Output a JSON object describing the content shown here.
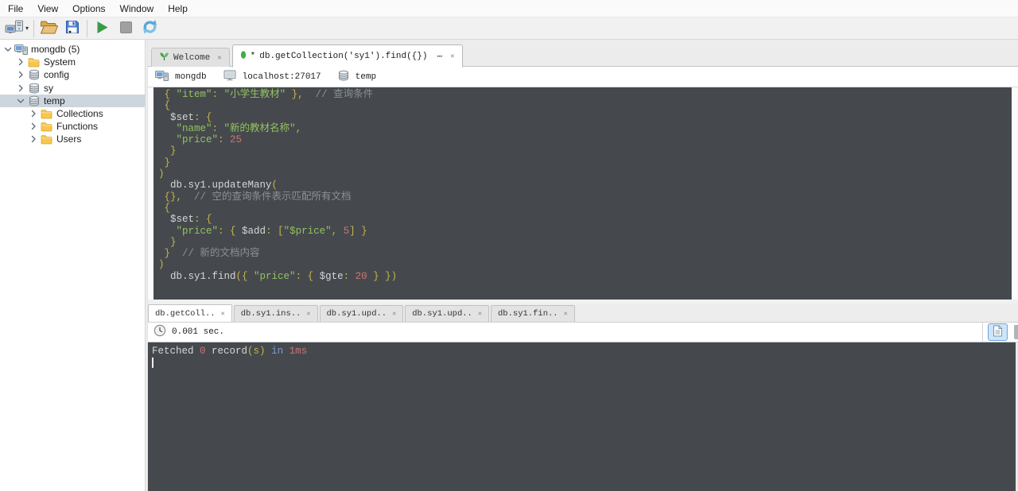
{
  "colors": {
    "editor-bg": "#45494d",
    "token-plain": "#d4d7d9",
    "token-yellow": "#c3b54b",
    "token-green": "#93c25f",
    "token-number": "#cd7572",
    "token-comment": "#8a9197",
    "token-blue": "#7d9cd0",
    "selection-bg": "#cdd6dd",
    "view-btn-bg": "#cfe4f6",
    "view-btn-border": "#6fa6d8"
  },
  "menu_bar": {
    "items": [
      "File",
      "View",
      "Options",
      "Window",
      "Help"
    ]
  },
  "toolbar": {
    "groups": [
      [
        {
          "name": "connect",
          "icon": "connect-icon",
          "dropdown": true
        }
      ],
      [
        {
          "name": "open-file",
          "icon": "folder-open-icon"
        },
        {
          "name": "save",
          "icon": "save-icon"
        }
      ],
      [
        {
          "name": "execute-query",
          "icon": "play-icon"
        },
        {
          "name": "stop",
          "icon": "stop-icon"
        },
        {
          "name": "rotate-results",
          "icon": "rotate-icon"
        }
      ]
    ]
  },
  "sidebar": {
    "tree": [
      {
        "label": "mongdb (5)",
        "icon": "server-icon",
        "chevron": "down",
        "level": 0,
        "selected": false
      },
      {
        "label": "System",
        "icon": "folder-icon",
        "chevron": "right",
        "level": 1,
        "selected": false
      },
      {
        "label": "config",
        "icon": "database-icon",
        "chevron": "right",
        "level": 1,
        "selected": false
      },
      {
        "label": "sy",
        "icon": "database-icon",
        "chevron": "right",
        "level": 1,
        "selected": false
      },
      {
        "label": "temp",
        "icon": "database-icon",
        "chevron": "down",
        "level": 1,
        "selected": true
      },
      {
        "label": "Collections",
        "icon": "folder-icon",
        "chevron": "right",
        "level": 2,
        "selected": false
      },
      {
        "label": "Functions",
        "icon": "folder-icon",
        "chevron": "right",
        "level": 2,
        "selected": false
      },
      {
        "label": "Users",
        "icon": "folder-icon",
        "chevron": "right",
        "level": 2,
        "selected": false
      }
    ]
  },
  "tab_bar": {
    "welcome_tab": {
      "label": "Welcome",
      "icon": "leaf-icon",
      "close": "✕"
    },
    "query_tab": {
      "icon": "green-dot-icon",
      "modified": "*",
      "label": "db.getCollection('sy1').find({})",
      "overflow": "⋯",
      "close": "✕"
    }
  },
  "breadcrumb": {
    "server": {
      "label": "mongdb",
      "icon": "server-icon"
    },
    "host": {
      "label": "localhost:27017",
      "icon": "monitor-icon"
    },
    "database": {
      "label": "temp",
      "icon": "database-icon"
    }
  },
  "editor": {
    "lines": [
      [
        {
          "t": " ",
          "c": "p"
        },
        {
          "t": "{ ",
          "c": "y"
        },
        {
          "t": "\"item\"",
          "c": "g"
        },
        {
          "t": ": ",
          "c": "y"
        },
        {
          "t": "\"小学生教材\"",
          "c": "g"
        },
        {
          "t": " },",
          "c": "y"
        },
        {
          "t": "  ",
          "c": "p"
        },
        {
          "t": "// 查询条件",
          "c": "c"
        }
      ],
      [
        {
          "t": " ",
          "c": "p"
        },
        {
          "t": "{",
          "c": "y"
        }
      ],
      [
        {
          "t": "  ",
          "c": "p"
        },
        {
          "t": "$set",
          "c": "p"
        },
        {
          "t": ": {",
          "c": "y"
        }
      ],
      [
        {
          "t": "   ",
          "c": "p"
        },
        {
          "t": "\"name\"",
          "c": "g"
        },
        {
          "t": ": ",
          "c": "y"
        },
        {
          "t": "\"新的教材名称\"",
          "c": "g"
        },
        {
          "t": ",",
          "c": "y"
        }
      ],
      [
        {
          "t": "   ",
          "c": "p"
        },
        {
          "t": "\"price\"",
          "c": "g"
        },
        {
          "t": ": ",
          "c": "y"
        },
        {
          "t": "25",
          "c": "n"
        }
      ],
      [
        {
          "t": "  ",
          "c": "p"
        },
        {
          "t": "}",
          "c": "y"
        }
      ],
      [
        {
          "t": " ",
          "c": "p"
        },
        {
          "t": "}",
          "c": "y"
        }
      ],
      [
        {
          "t": ")",
          "c": "y"
        }
      ],
      [
        {
          "t": "  ",
          "c": "p"
        },
        {
          "t": "db.sy1.updateMany",
          "c": "p"
        },
        {
          "t": "(",
          "c": "y"
        }
      ],
      [
        {
          "t": " ",
          "c": "p"
        },
        {
          "t": "{},",
          "c": "y"
        },
        {
          "t": "  ",
          "c": "p"
        },
        {
          "t": "// 空的查询条件表示匹配所有文档",
          "c": "c"
        }
      ],
      [
        {
          "t": " ",
          "c": "p"
        },
        {
          "t": "{",
          "c": "y"
        }
      ],
      [
        {
          "t": "  ",
          "c": "p"
        },
        {
          "t": "$set",
          "c": "p"
        },
        {
          "t": ": {",
          "c": "y"
        }
      ],
      [
        {
          "t": "   ",
          "c": "p"
        },
        {
          "t": "\"price\"",
          "c": "g"
        },
        {
          "t": ": { ",
          "c": "y"
        },
        {
          "t": "$add",
          "c": "p"
        },
        {
          "t": ": [",
          "c": "y"
        },
        {
          "t": "\"$price\"",
          "c": "g"
        },
        {
          "t": ", ",
          "c": "y"
        },
        {
          "t": "5",
          "c": "n"
        },
        {
          "t": "] }",
          "c": "y"
        }
      ],
      [
        {
          "t": "  ",
          "c": "p"
        },
        {
          "t": "}",
          "c": "y"
        }
      ],
      [
        {
          "t": " ",
          "c": "p"
        },
        {
          "t": "}",
          "c": "y"
        },
        {
          "t": "  ",
          "c": "p"
        },
        {
          "t": "// 新的文档内容",
          "c": "c"
        }
      ],
      [
        {
          "t": ")",
          "c": "y"
        }
      ],
      [
        {
          "t": "  ",
          "c": "p"
        },
        {
          "t": "db.sy1.find",
          "c": "p"
        },
        {
          "t": "({ ",
          "c": "y"
        },
        {
          "t": "\"price\"",
          "c": "g"
        },
        {
          "t": ": { ",
          "c": "y"
        },
        {
          "t": "$gte",
          "c": "p"
        },
        {
          "t": ": ",
          "c": "y"
        },
        {
          "t": "20",
          "c": "n"
        },
        {
          "t": " } })",
          "c": "y"
        }
      ]
    ]
  },
  "result_tabs": {
    "close": "✕",
    "tabs": [
      {
        "label": "db.getColl..",
        "active": true
      },
      {
        "label": "db.sy1.ins..",
        "active": false
      },
      {
        "label": "db.sy1.upd..",
        "active": false
      },
      {
        "label": "db.sy1.upd..",
        "active": false
      },
      {
        "label": "db.sy1.fin..",
        "active": false
      }
    ]
  },
  "timing_bar": {
    "icon": "clock-icon",
    "duration": "0.001 sec."
  },
  "output": {
    "lines": [
      [
        {
          "t": "Fetched ",
          "c": "p"
        },
        {
          "t": "0",
          "c": "n"
        },
        {
          "t": " record",
          "c": "p"
        },
        {
          "t": "(s)",
          "c": "y"
        },
        {
          "t": " ",
          "c": "p"
        },
        {
          "t": "in",
          "c": "b"
        },
        {
          "t": " ",
          "c": "p"
        },
        {
          "t": "1ms",
          "c": "n"
        }
      ]
    ],
    "cursor": true
  }
}
